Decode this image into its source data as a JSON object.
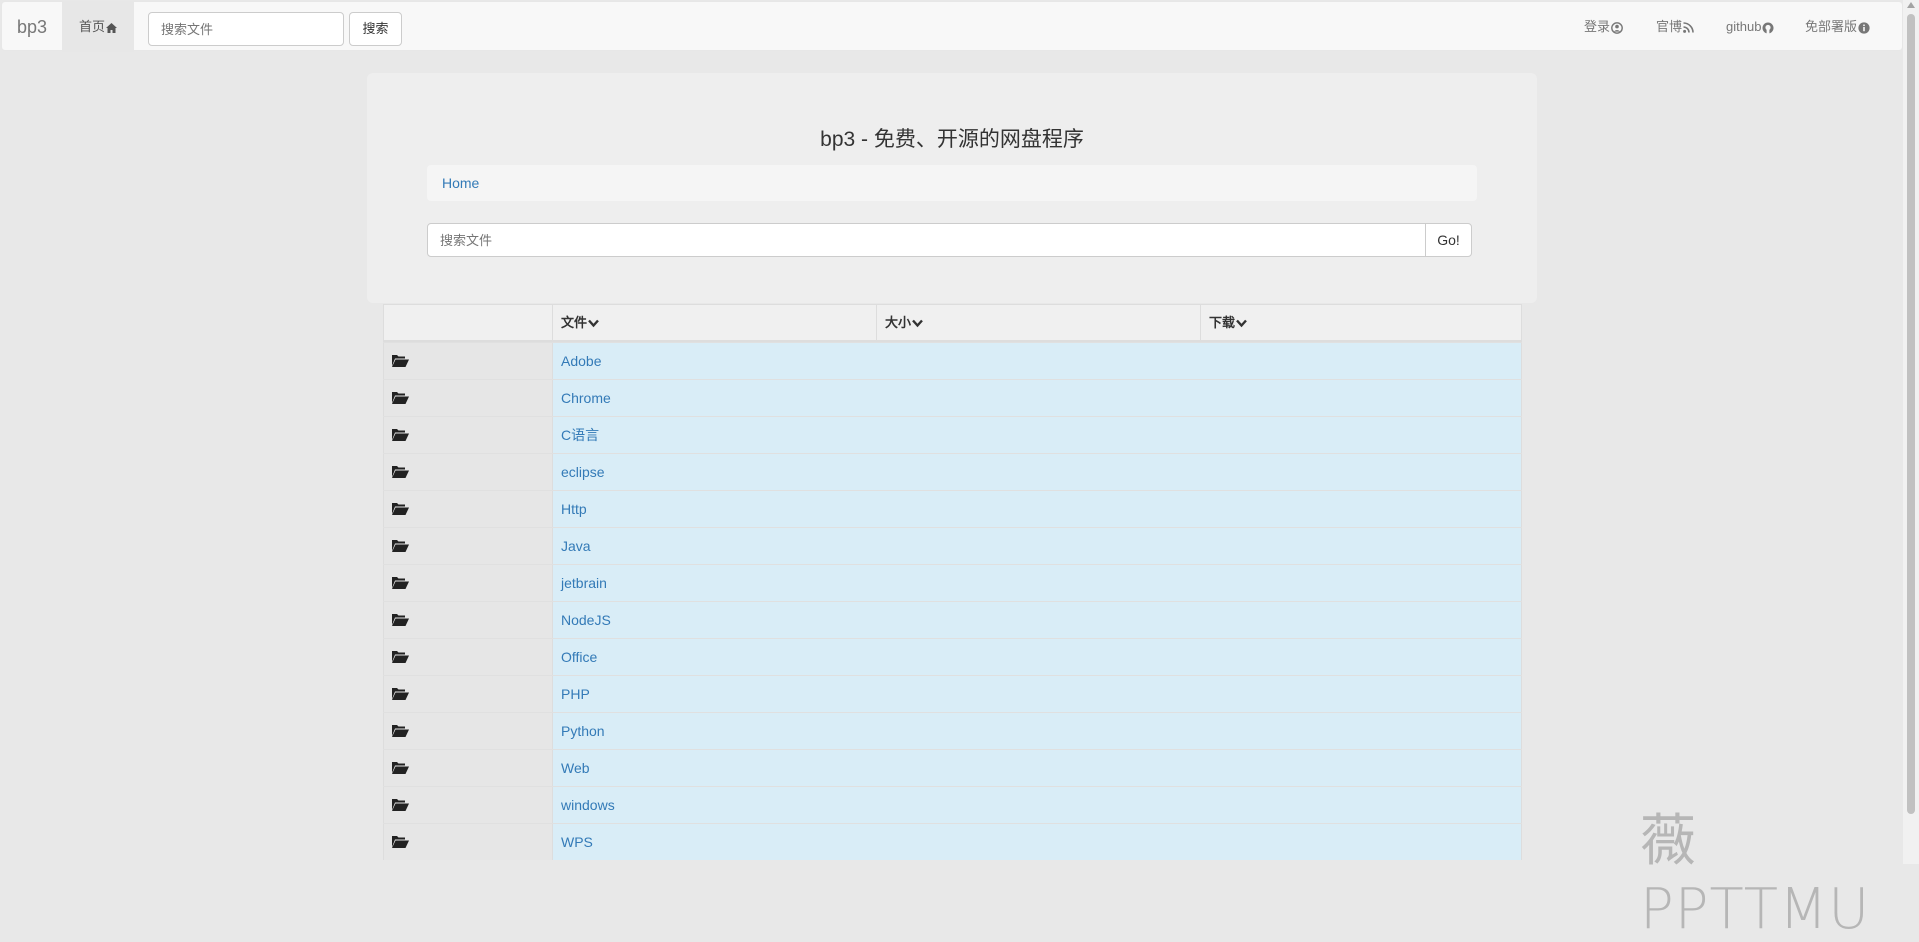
{
  "navbar": {
    "brand": "bp3",
    "home_label": "首页",
    "search_placeholder": "搜索文件",
    "search_button": "搜索",
    "right_links": [
      {
        "label": "登录",
        "icon": "user-circle-icon"
      },
      {
        "label": "官博",
        "icon": "rss-icon"
      },
      {
        "label": "github",
        "icon": "github-icon"
      },
      {
        "label": "免部署版",
        "icon": "info-circle-icon"
      }
    ]
  },
  "hero": {
    "title": "bp3 - 免费、开源的网盘程序",
    "breadcrumb": "Home",
    "search_placeholder": "搜索文件",
    "go_button": "Go!"
  },
  "table": {
    "headers": [
      "文件",
      "大小",
      "下载"
    ],
    "rows": [
      "Adobe",
      "Chrome",
      "C语言",
      "eclipse",
      "Http",
      "Java",
      "jetbrain",
      "NodeJS",
      "Office",
      "PHP",
      "Python",
      "Web",
      "windows",
      "WPS"
    ]
  },
  "watermark": "薇 PPTTMU"
}
